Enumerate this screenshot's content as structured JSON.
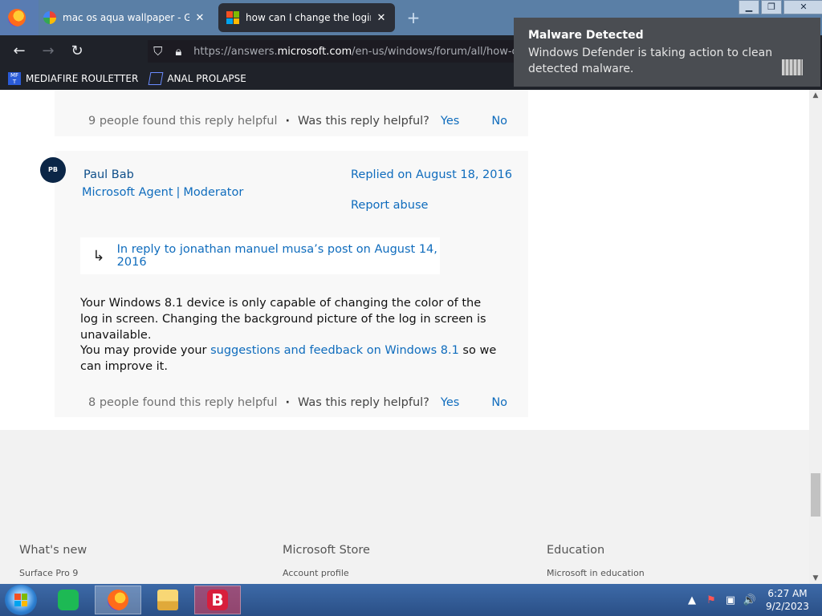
{
  "browser": {
    "tabs": [
      {
        "label": "mac os aqua wallpaper - Google",
        "close": "✕"
      },
      {
        "label": "how can I change the login scre",
        "close": "✕"
      }
    ],
    "new_tab": "+",
    "window_controls": {
      "minimize": "▁",
      "maximize": "❐",
      "close": "✕"
    },
    "nav": {
      "back": "←",
      "forward": "→",
      "reload": "↻"
    },
    "url": {
      "prefix": "https://answers.",
      "domain": "microsoft.com",
      "path": "/en-us/windows/forum/all/how-can"
    },
    "bookmarks": [
      {
        "label": "MEDIAFIRE ROULETTER",
        "icon_text": "MF T"
      },
      {
        "label": "ANAL PROLAPSE"
      }
    ]
  },
  "notification": {
    "title": "Malware Detected",
    "body": "Windows Defender is taking action to clean detected malware."
  },
  "thread": {
    "reply1": {
      "helpful_count": "9 people found this reply helpful",
      "dot": "·",
      "question": "Was this reply helpful?",
      "yes": "Yes",
      "no": "No"
    },
    "reply2": {
      "initials": "PB",
      "author": "Paul Bab",
      "role1": "Microsoft Agent",
      "role_sep": "|",
      "role2": "Moderator",
      "replied": "Replied on August 18, 2016",
      "report": "Report abuse",
      "in_reply_arrow": "↳",
      "in_reply": "In reply to jonathan manuel musa’s post on August 14, 2016",
      "para1": "Your Windows 8.1 device is only capable of changing the color of the log in screen. Changing the background picture of the log in screen is unavailable.",
      "para2_before": "You may provide your ",
      "para2_link": "suggestions and feedback on Windows 8.1",
      "para2_after": " so we can improve it.",
      "helpful_count": "8 people found this reply helpful",
      "dot": "·",
      "question": "Was this reply helpful?",
      "yes": "Yes",
      "no": "No"
    }
  },
  "footer": {
    "columns": [
      {
        "heading": "What's new",
        "first_link": "Surface Pro 9"
      },
      {
        "heading": "Microsoft Store",
        "first_link": "Account profile"
      },
      {
        "heading": "Education",
        "first_link": "Microsoft in education"
      }
    ]
  },
  "taskbar": {
    "time": "6:27 AM",
    "date": "9/2/2023",
    "tray": {
      "up": "▲",
      "flag": "⚑",
      "network": "▣",
      "volume": "🔊"
    }
  },
  "scrollbar": {
    "up": "▲",
    "down": "▼"
  },
  "colors": {
    "link": "#0f6cbd",
    "tabbar": "#5a7fa6",
    "toast": "#4a4d52"
  }
}
